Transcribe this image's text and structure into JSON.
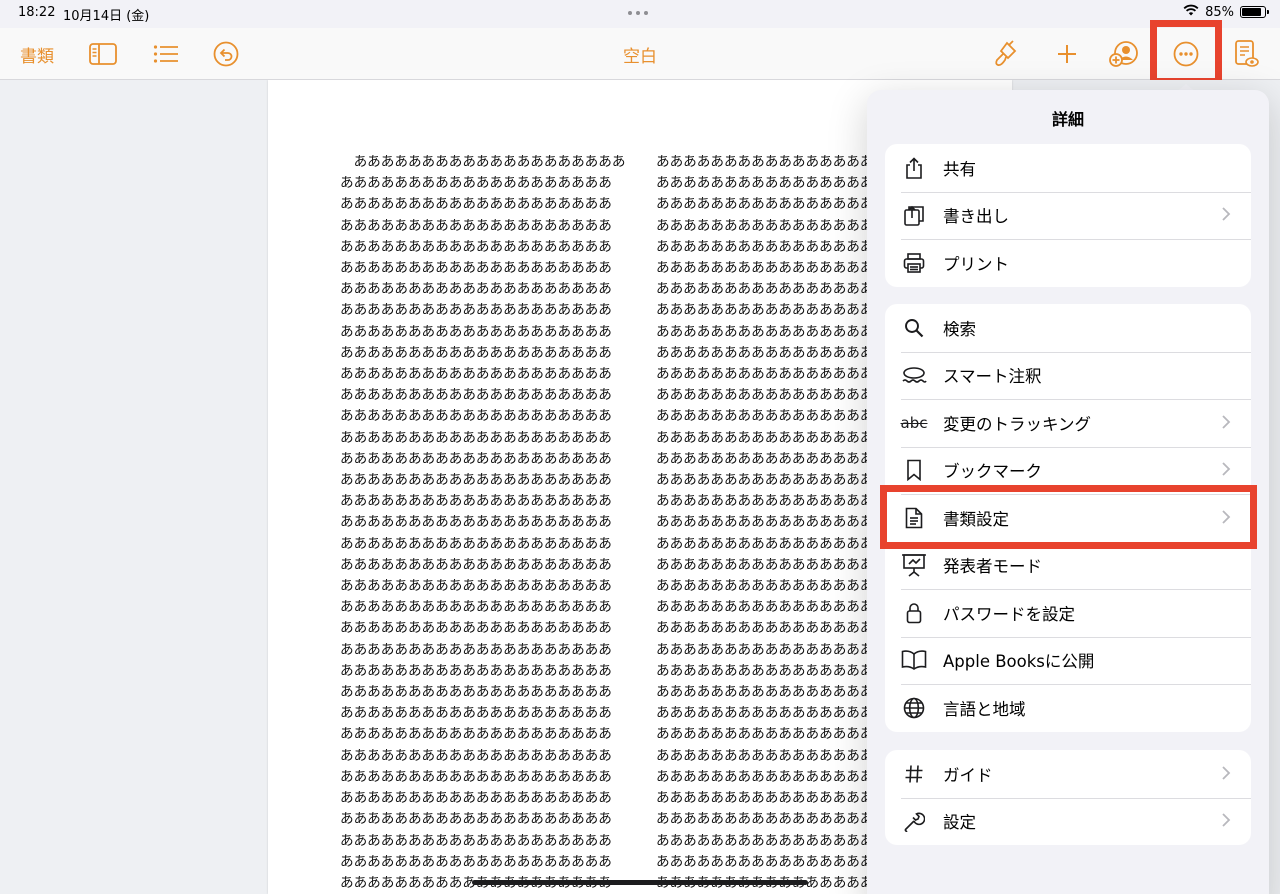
{
  "status_bar": {
    "time": "18:22",
    "date": "10月14日 (金)",
    "battery": "85%",
    "battery_level": 0.85
  },
  "toolbar": {
    "docs_label": "書類",
    "title": "空白",
    "accent_color": "#e8902e",
    "highlight_color": "#e8432e"
  },
  "document": {
    "column1_lines": [
      "　ああああああああああああああああああああ",
      "ああああああああああああああああああああ",
      "ああああああああああああああああああああ",
      "ああああああああああああああああああああ",
      "ああああああああああああああああああああ",
      "ああああああああああああああああああああ",
      "ああああああああああああああああああああ",
      "ああああああああああああああああああああ",
      "ああああああああああああああああああああ",
      "ああああああああああああああああああああ",
      "ああああああああああああああああああああ",
      "ああああああああああああああああああああ",
      "ああああああああああああああああああああ",
      "ああああああああああああああああああああ",
      "ああああああああああああああああああああ",
      "ああああああああああああああああああああ",
      "ああああああああああああああああああああ",
      "ああああああああああああああああああああ",
      "ああああああああああああああああああああ",
      "ああああああああああああああああああああ",
      "ああああああああああああああああああああ",
      "ああああああああああああああああああああ",
      "ああああああああああああああああああああ",
      "ああああああああああああああああああああ",
      "ああああああああああああああああああああ",
      "ああああああああああああああああああああ",
      "ああああああああああああああああああああ",
      "ああああああああああああああああああああ",
      "ああああああああああああああああああああ",
      "ああああああああああああああああああああ",
      "ああああああああああああああああああああ",
      "ああああああああああああああああああああ",
      "ああああああああああああああああああああ",
      "ああああああああああああああああああああ",
      "ああああああああああああああああああああ"
    ],
    "column2_lines": [
      "ああああああああああああああああああああ",
      "ああああああああああああああああああああ",
      "ああああああああああああああああああああ",
      "ああああああああああああああああああああ",
      "ああああああああああああああああああああ",
      "ああああああああああああああああああああ",
      "ああああああああああああああああああああ",
      "ああああああああああああああああああああ",
      "ああああああああああああああああああああ",
      "ああああああああああああああああああああ",
      "ああああああああああああああああああああ",
      "ああああああああああああああああああああ",
      "ああああああああああああああああああああ",
      "ああああああああああああああああああああ",
      "ああああああああああああああああああああ",
      "ああああああああああああああああああああ",
      "ああああああああああああああああああああ",
      "ああああああああああああああああああああ",
      "ああああああああああああああああああああ",
      "ああああああああああああああああああああ",
      "ああああああああああああああああああああ",
      "ああああああああああああああああああああ",
      "ああああああああああああああああああああ",
      "ああああああああああああああああああああ",
      "ああああああああああああああああああああ",
      "ああああああああああああああああああああ",
      "ああああああああああああああああああああ",
      "ああああああああああああああああああああ",
      "ああああああああああああああああああああ",
      "ああああああああああああああああああああ",
      "ああああああああああああああああああああ",
      "ああああああああああああああああああああ",
      "ああああああああああああああああああああ",
      "ああああああああああああああああああああ",
      "ああああああああああああああああああああ"
    ]
  },
  "popover": {
    "title": "詳細",
    "groups": [
      {
        "items": [
          {
            "label": "共有",
            "icon": "share-icon",
            "chevron": false
          },
          {
            "label": "書き出し",
            "icon": "export-icon",
            "chevron": true
          },
          {
            "label": "プリント",
            "icon": "printer-icon",
            "chevron": false
          }
        ]
      },
      {
        "items": [
          {
            "label": "検索",
            "icon": "search-icon",
            "chevron": false
          },
          {
            "label": "スマート注釈",
            "icon": "smart-annotation-icon",
            "chevron": false
          },
          {
            "label": "変更のトラッキング",
            "icon": "track-changes-icon",
            "icon_text": "abc",
            "chevron": true
          },
          {
            "label": "ブックマーク",
            "icon": "bookmark-icon",
            "chevron": true
          },
          {
            "label": "書類設定",
            "icon": "document-icon",
            "chevron": true,
            "highlighted": true
          },
          {
            "label": "発表者モード",
            "icon": "presenter-icon",
            "chevron": false
          },
          {
            "label": "パスワードを設定",
            "icon": "lock-icon",
            "chevron": false
          },
          {
            "label": "Apple Booksに公開",
            "icon": "book-icon",
            "chevron": false
          },
          {
            "label": "言語と地域",
            "icon": "globe-icon",
            "chevron": false
          }
        ]
      },
      {
        "items": [
          {
            "label": "ガイド",
            "icon": "hash-icon",
            "chevron": true
          },
          {
            "label": "設定",
            "icon": "wrench-icon",
            "chevron": true
          }
        ]
      }
    ]
  }
}
